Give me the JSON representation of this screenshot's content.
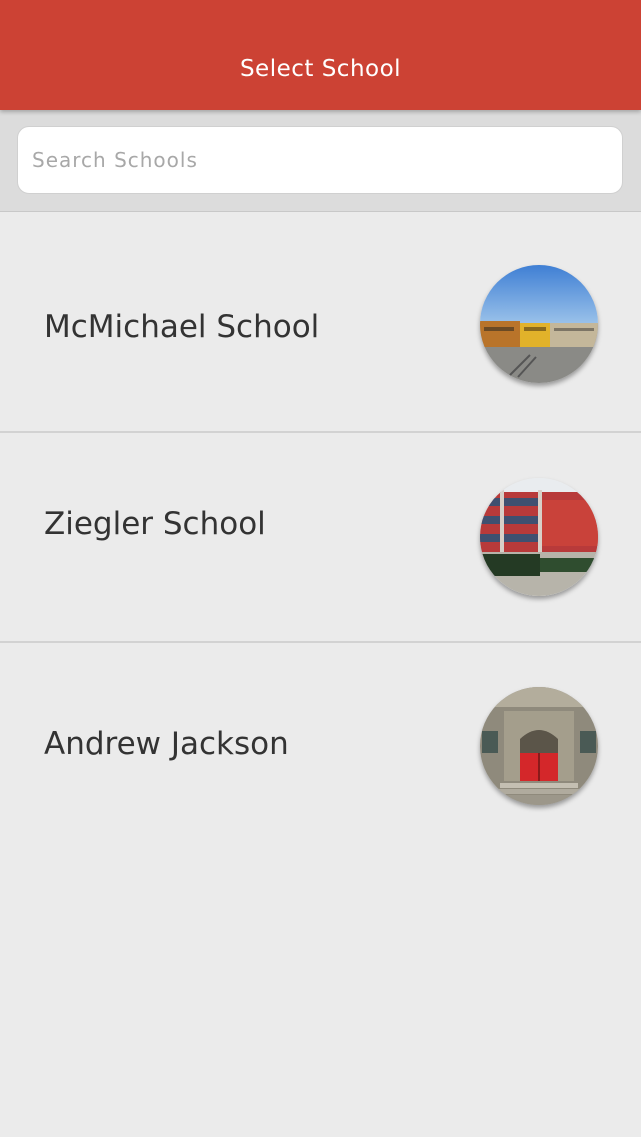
{
  "header": {
    "title": "Select School"
  },
  "search": {
    "placeholder": "Search Schools",
    "value": ""
  },
  "schools": [
    {
      "name": "McMichael School",
      "image_icon": "school-building-photo"
    },
    {
      "name": "Ziegler School",
      "image_icon": "school-building-photo"
    },
    {
      "name": "Andrew Jackson",
      "image_icon": "school-building-photo"
    }
  ],
  "colors": {
    "header_bg": "#cc4234",
    "page_bg": "#ebebeb",
    "search_bar_bg": "#dcdcdc"
  }
}
